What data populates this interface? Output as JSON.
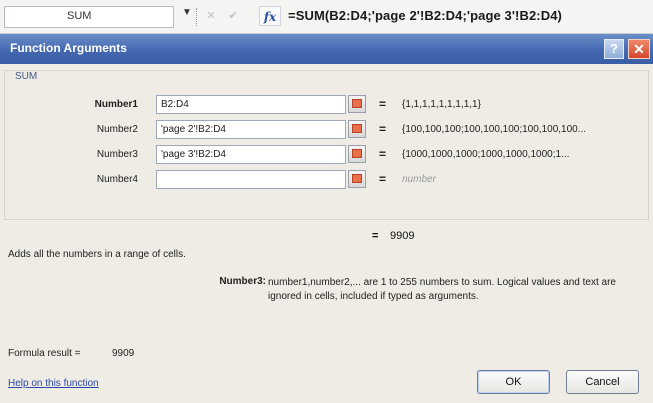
{
  "formula_bar": {
    "name_box": "SUM",
    "dropdown_glyph": "▼",
    "cancel_glyph": "✕",
    "enter_glyph": "✔",
    "fx_label": "fx",
    "formula": "=SUM(B2:D4;'page 2'!B2:D4;'page 3'!B2:D4)"
  },
  "dialog": {
    "title": "Function Arguments",
    "help_glyph": "?",
    "close_glyph": "✕",
    "function_name": "SUM",
    "arguments": [
      {
        "label": "Number1",
        "value": "B2:D4",
        "result": "{1,1,1,1,1,1,1,1,1}",
        "bold": true
      },
      {
        "label": "Number2",
        "value": "'page 2'!B2:D4",
        "result": "{100,100,100;100,100,100;100,100,100...",
        "bold": false
      },
      {
        "label": "Number3",
        "value": "'page 3'!B2:D4",
        "result": "{1000,1000,1000;1000,1000,1000;1...",
        "bold": false
      },
      {
        "label": "Number4",
        "value": "",
        "result": "number",
        "bold": false
      }
    ],
    "equals": "=",
    "total_value": "9909",
    "description": "Adds all the numbers in a range of cells.",
    "arg_help_label": "Number3:",
    "arg_help_text": "number1,number2,... are 1 to 255 numbers to sum. Logical values and text are ignored in cells, included if typed as arguments.",
    "formula_result_label": "Formula result =",
    "formula_result_value": "9909",
    "help_link": "Help on this function",
    "ok_label": "OK",
    "cancel_label": "Cancel"
  },
  "colors": {
    "title_bar": "#4468b0",
    "close_button": "#d3472c",
    "link": "#2a48a8"
  }
}
